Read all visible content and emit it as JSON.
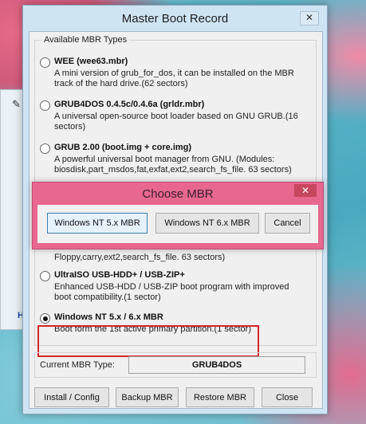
{
  "dialog": {
    "title": "Master Boot Record",
    "close_glyph": "✕",
    "group_caption": "Available MBR Types",
    "options": [
      {
        "name": "WEE (wee63.mbr)",
        "desc": "A mini version of grub_for_dos, it can be installed on the MBR track of the hard drive.(62 sectors)",
        "selected": false
      },
      {
        "name": "GRUB4DOS 0.4.5c/0.4.6a (grldr.mbr)",
        "desc": "A universal open-source boot loader based on GNU GRUB.(16 sectors)",
        "selected": false
      },
      {
        "name": "GRUB 2.00 (boot.img + core.img)",
        "desc": "A powerful universal boot manager from GNU. (Modules: biosdisk,part_msdos,fat,exfat,ext2,search_fs_file. 63 sectors)",
        "selected": false
      },
      {
        "name": "UltraISO USB-HDD+ / USB-ZIP+",
        "desc": "Enhanced USB-HDD / USB-ZIP boot program with improved boot compatibility.(1 sector)",
        "selected": false
      },
      {
        "name": "Windows NT 5.x / 6.x MBR",
        "desc": "Boot form the 1st active primary partition.(1 sector)",
        "selected": true
      }
    ],
    "partially_hidden_text": "Floppy,carry,ext2,search_fs_file. 63 sectors)",
    "current_mbr_label": "Current MBR Type:",
    "current_mbr_value": "GRUB4DOS",
    "buttons": {
      "install": "Install / Config",
      "backup": "Backup MBR",
      "restore": "Restore MBR",
      "close": "Close"
    }
  },
  "popup": {
    "title": "Choose MBR",
    "close_glyph": "✕",
    "buttons": {
      "nt5": "Windows NT 5.x MBR",
      "nt6": "Windows NT 6.x MBR",
      "cancel": "Cancel"
    }
  },
  "background_window": {
    "icon": "pen-icon",
    "letter": "H"
  },
  "colors": {
    "highlight": "#d6262b",
    "popup_bg": "#e8678f",
    "dialog_frame": "#cfe4f3"
  }
}
